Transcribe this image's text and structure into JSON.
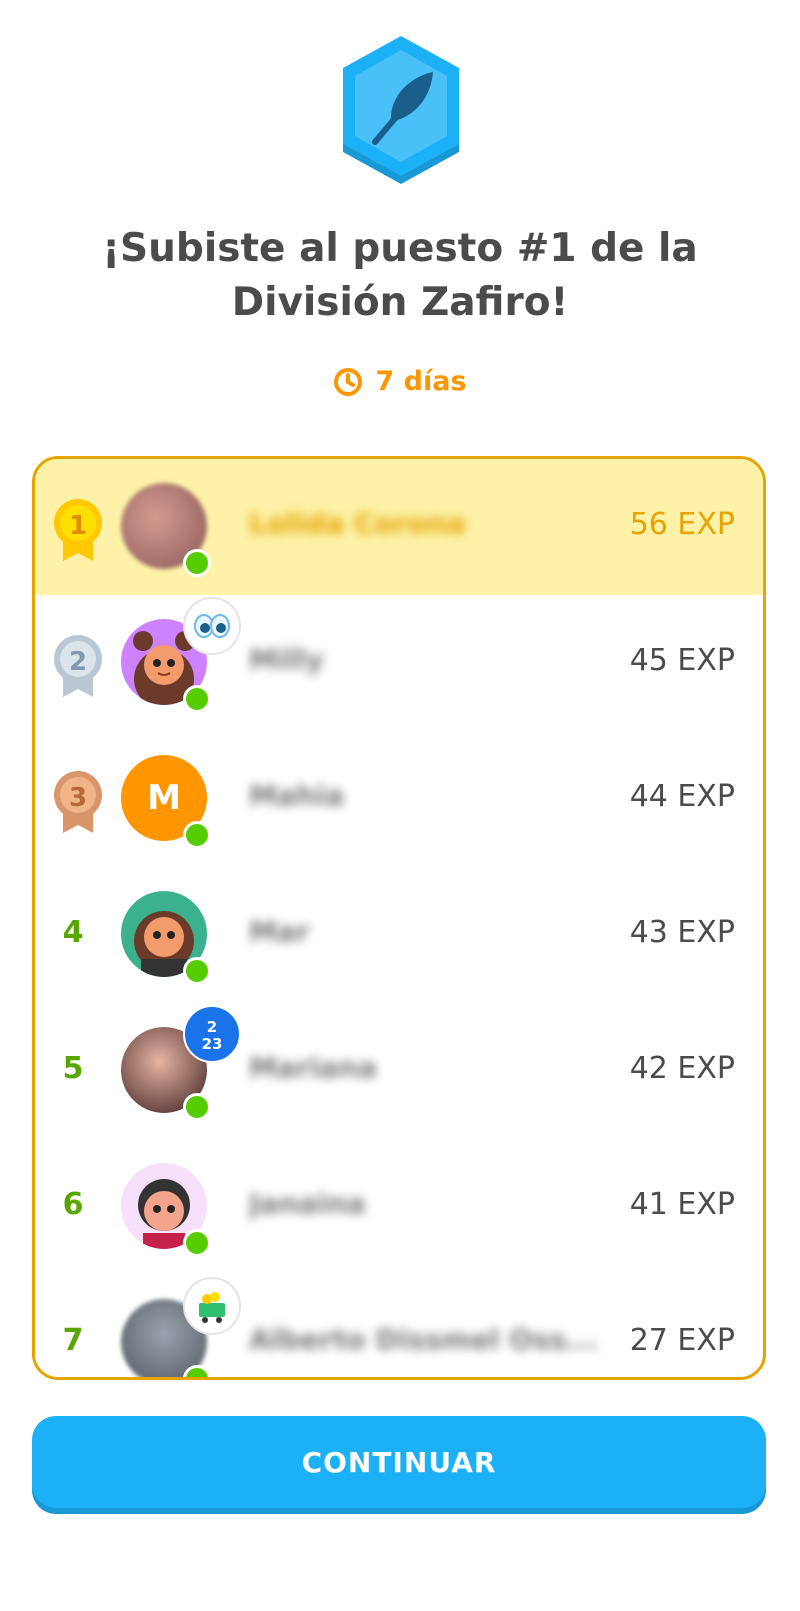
{
  "league": {
    "badge_icon": "feather-icon",
    "badge_color": "#1cb0f6",
    "title_line1": "¡Subiste al puesto #1 de la",
    "title_line2": "División Zafiro!",
    "timer_icon": "clock-icon",
    "timer_text": "7 días",
    "timer_color": "#ff9600"
  },
  "leaderboard": {
    "border_color": "#e5a400",
    "highlight_color": "#fdf2a8",
    "rows": [
      {
        "rank": "1",
        "medal": "gold",
        "avatar": "photo",
        "avatar_letter": "",
        "name": "Lolida Corona",
        "exp": "56 EXP",
        "deco": ""
      },
      {
        "rank": "2",
        "medal": "silver",
        "avatar": "character-girl",
        "avatar_letter": "",
        "name": "Milly",
        "exp": "45 EXP",
        "deco": "eyes-icon"
      },
      {
        "rank": "3",
        "medal": "bronze",
        "avatar": "letter",
        "avatar_letter": "M",
        "name": "Mahia",
        "exp": "44 EXP",
        "deco": ""
      },
      {
        "rank": "4",
        "medal": "",
        "avatar": "character-girl",
        "avatar_letter": "",
        "name": "Mar",
        "exp": "43 EXP",
        "deco": ""
      },
      {
        "rank": "5",
        "medal": "",
        "avatar": "photo",
        "avatar_letter": "",
        "name": "Mariana",
        "exp": "42 EXP",
        "deco": "2023-icon"
      },
      {
        "rank": "6",
        "medal": "",
        "avatar": "character-girl",
        "avatar_letter": "",
        "name": "Janaina",
        "exp": "41 EXP",
        "deco": ""
      },
      {
        "rank": "7",
        "medal": "",
        "avatar": "photo",
        "avatar_letter": "",
        "name": "Alberto Dissmel Oss...",
        "exp": "27 EXP",
        "deco": "treasure-cart-icon"
      }
    ]
  },
  "continue_button": {
    "label": "CONTINUAR",
    "color": "#1cb0f6"
  }
}
